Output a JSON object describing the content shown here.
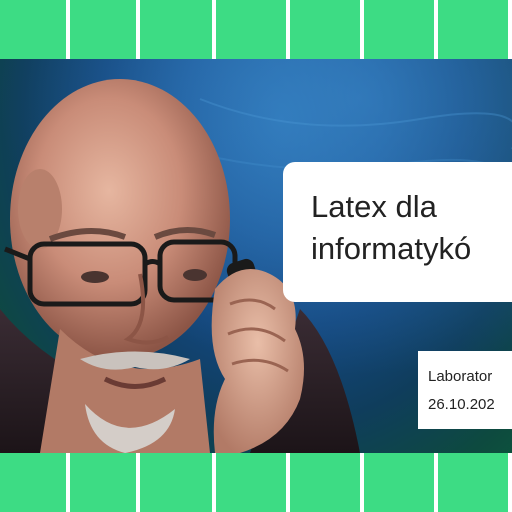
{
  "title_card": {
    "line1": "Latex dla",
    "line2": "informatykó"
  },
  "info_card": {
    "line1": "Laborator",
    "line2": "26.10.202"
  },
  "colors": {
    "strip_green": "#3ddc84",
    "background_blue": "#1e5a9a",
    "background_green": "#0c5a3a",
    "card_white": "#ffffff"
  },
  "tiles_per_strip": 8
}
